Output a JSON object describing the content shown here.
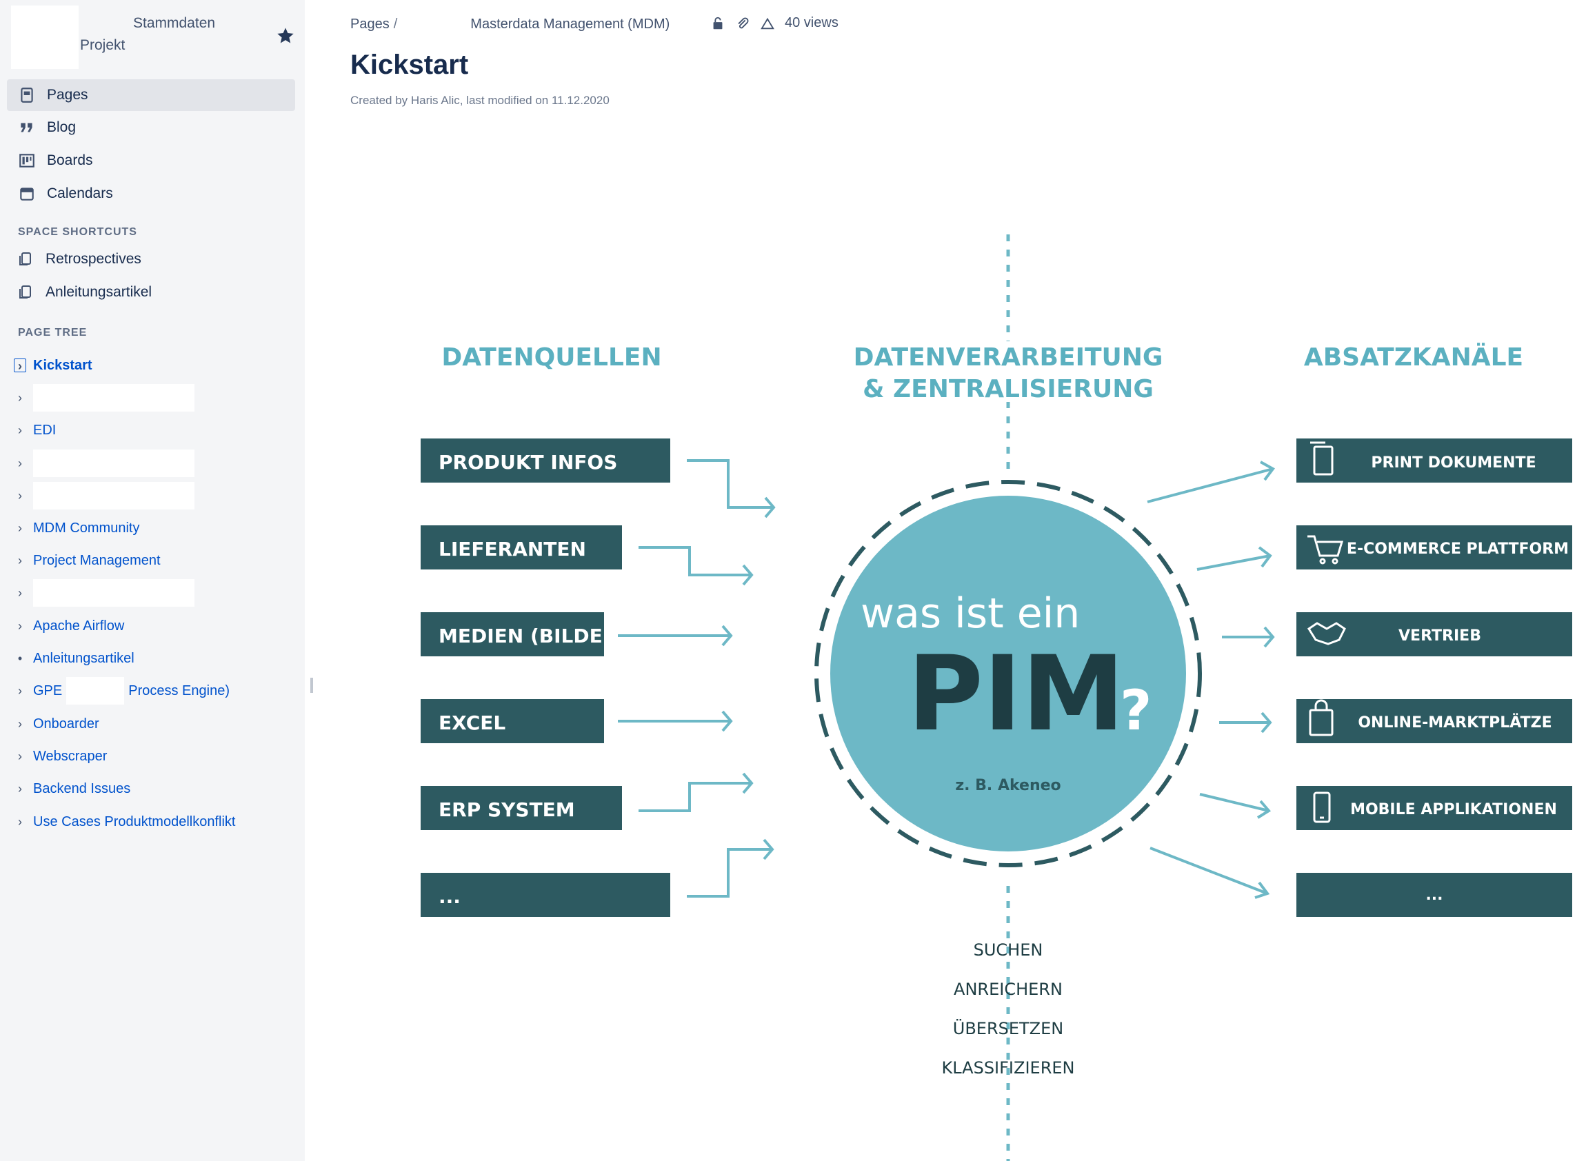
{
  "space": {
    "name_line1": "Stammdaten",
    "name_line2": "Projekt"
  },
  "nav": {
    "items": [
      {
        "label": "Pages",
        "icon": "pages-icon",
        "active": true
      },
      {
        "label": "Blog",
        "icon": "quote-icon",
        "active": false
      },
      {
        "label": "Boards",
        "icon": "board-icon",
        "active": false
      },
      {
        "label": "Calendars",
        "icon": "calendar-icon",
        "active": false
      }
    ]
  },
  "shortcuts": {
    "title": "SPACE SHORTCUTS",
    "items": [
      "Retrospectives",
      "Anleitungsartikel"
    ]
  },
  "tree": {
    "title": "PAGE TREE",
    "current": "Kickstart",
    "edi": "EDI",
    "mdm_community": "MDM Community",
    "project_management": "Project Management",
    "apache_airflow": "Apache Airflow",
    "anleitungsartikel": "Anleitungsartikel",
    "gpe_prefix": "GPE",
    "gpe_suffix": "Process Engine)",
    "onboarder": "Onboarder",
    "webscraper": "Webscraper",
    "backend_issues": "Backend Issues",
    "use_cases": "Use Cases Produktmodellkonflikt"
  },
  "breadcrumb": {
    "pages": "Pages",
    "parent": "Masterdata Management (MDM)",
    "views": "40 views"
  },
  "page": {
    "title": "Kickstart",
    "byline": "Created by Haris Alic, last modified on 11.12.2020"
  },
  "diagram": {
    "col_left": "DATENQUELLEN",
    "col_center_1": "DATENVERARBEITUNG",
    "col_center_2": "& ZENTRALISIERUNG",
    "col_right": "ABSATZKANÄLE",
    "sources": [
      "PRODUKT INFOS",
      "LIEFERANTEN",
      "MEDIEN (BILDER)",
      "EXCEL",
      "ERP SYSTEM",
      "..."
    ],
    "channels": [
      "PRINT DOKUMENTE",
      "E-COMMERCE PLATTFORM",
      "VERTRIEB",
      "ONLINE-MARKTPLÄTZE",
      "MOBILE APPLIKATIONEN",
      "..."
    ],
    "circle_line1": "was ist ein",
    "circle_big": "PIM",
    "circle_q": "?",
    "circle_sub": "z. B. Akeneo",
    "processes": [
      "SUCHEN",
      "ANREICHERN",
      "ÜBERSETZEN",
      "KLASSIFIZIEREN"
    ],
    "colors": {
      "dark": "#2d5a61",
      "teal": "#6db8c6",
      "title_teal": "#5bb0c0",
      "text_dark": "#1e3d43"
    }
  }
}
